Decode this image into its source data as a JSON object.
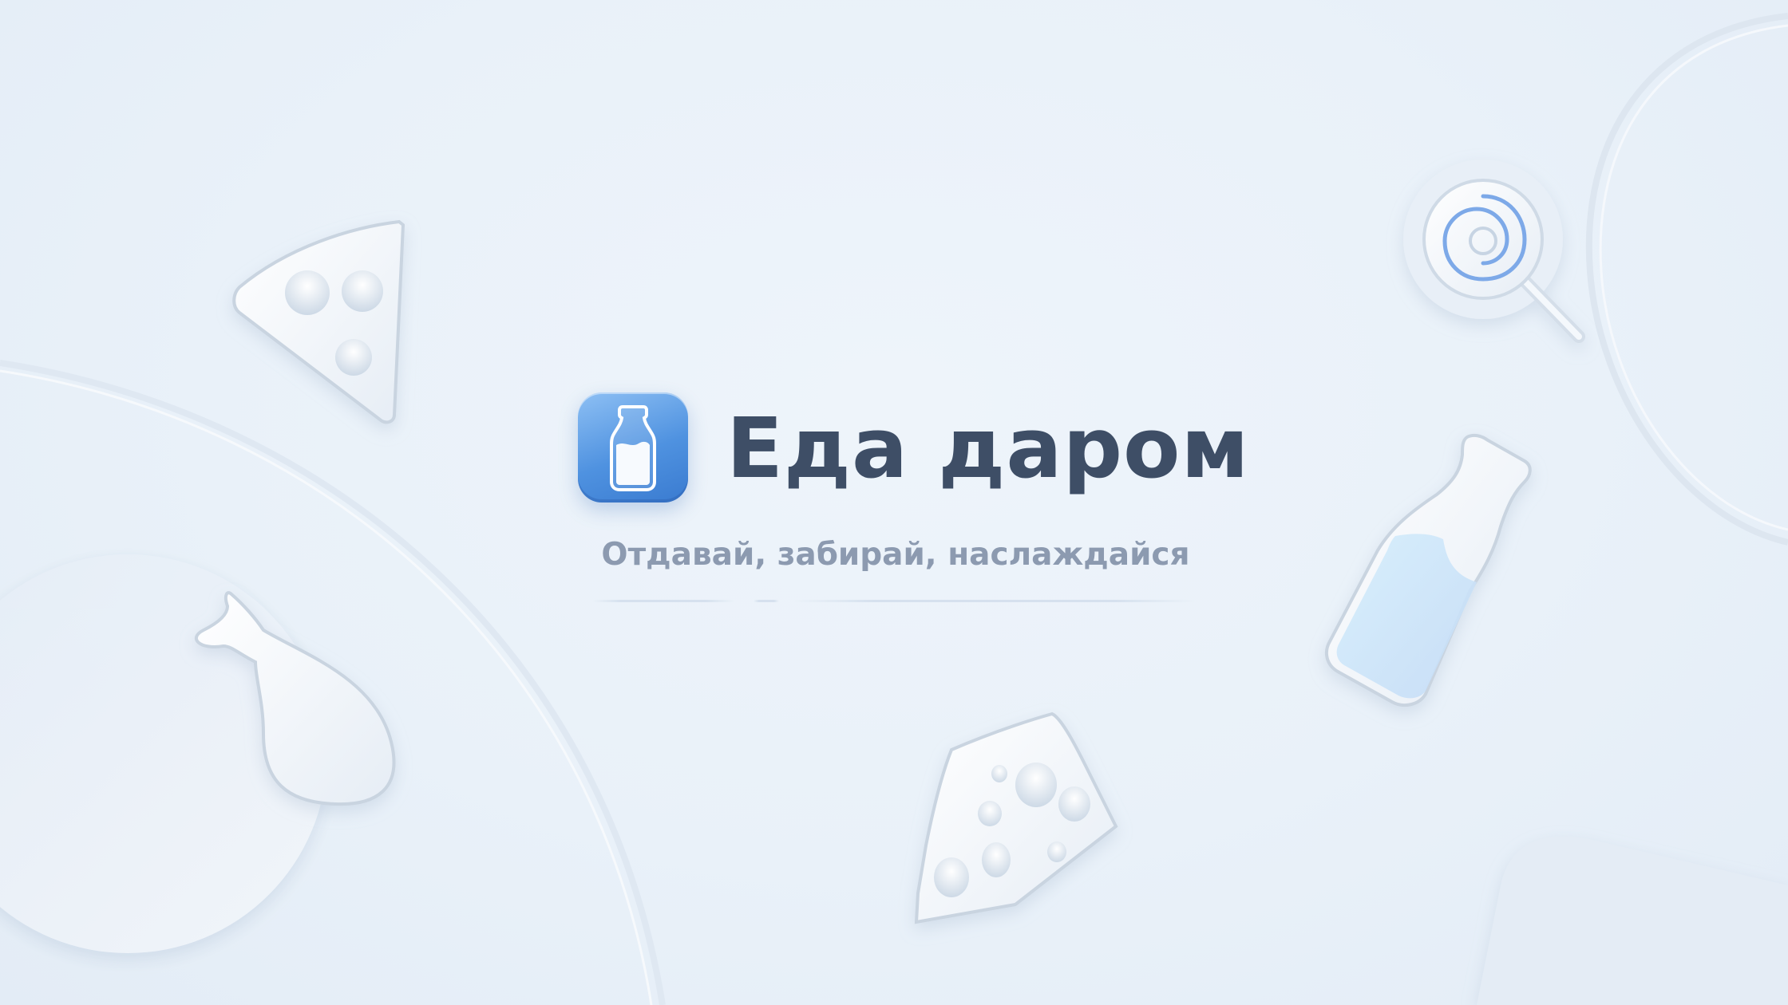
{
  "app": {
    "icon": "milk-bottle-icon",
    "title": "Еда даром",
    "tagline": "Отдавай, забирай, наслаждайся"
  },
  "decorations": [
    "cheese-wedge-icon",
    "chicken-leg-icon",
    "cheese-block-icon",
    "lollipop-icon",
    "milk-bottle-icon"
  ],
  "colors": {
    "background": "#eaf1f9",
    "title": "#3e4e66",
    "tagline": "#8c9ab0",
    "icon_accent": "#4f92e0"
  }
}
